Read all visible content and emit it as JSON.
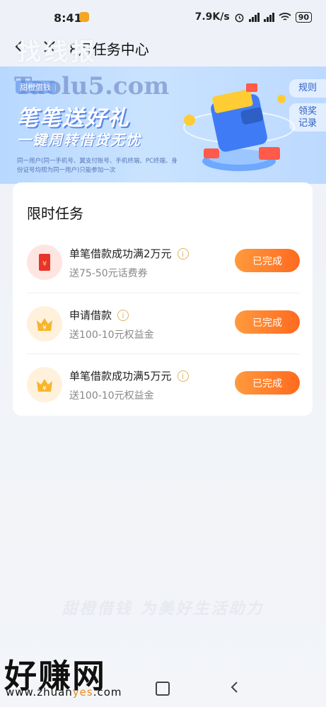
{
  "status_bar": {
    "time": "8:41",
    "network_speed": "7.9K/s",
    "battery": "90"
  },
  "nav": {
    "title": "8月任务中心",
    "watermark": "找线报"
  },
  "banner": {
    "brand": "甜橙借钱",
    "watermark": "Taolu5.com",
    "headline": "笔笔送好礼",
    "subheadline": "一键周转借贷无忧",
    "fineprint": "同一用户(同一手机号、翼支付账号、手机终端、PC终端、身份证号均视为同一用户)只能参加一次",
    "rules_label": "规则",
    "records_label": "领奖记录",
    "colors": {
      "accent": "#2d5fc4",
      "bg": "#c3dcff"
    }
  },
  "tasks_card": {
    "title": "限时任务",
    "items": [
      {
        "name": "单笔借款成功满2万元",
        "reward": "送75-50元话费券",
        "button": "已完成",
        "icon": "red-envelope-icon"
      },
      {
        "name": "申请借款",
        "reward": "送100-10元权益金",
        "button": "已完成",
        "icon": "crown-coin-icon"
      },
      {
        "name": "单笔借款成功满5万元",
        "reward": "送100-10元权益金",
        "button": "已完成",
        "icon": "crown-coin-icon"
      }
    ],
    "button_color": "#ff7a26"
  },
  "footer": {
    "slogan": "甜橙借钱  为美好生活助力",
    "watermark": "好赚网",
    "url_prefix": "www.zhuan",
    "url_highlight": "yes",
    "url_suffix": ".com"
  }
}
